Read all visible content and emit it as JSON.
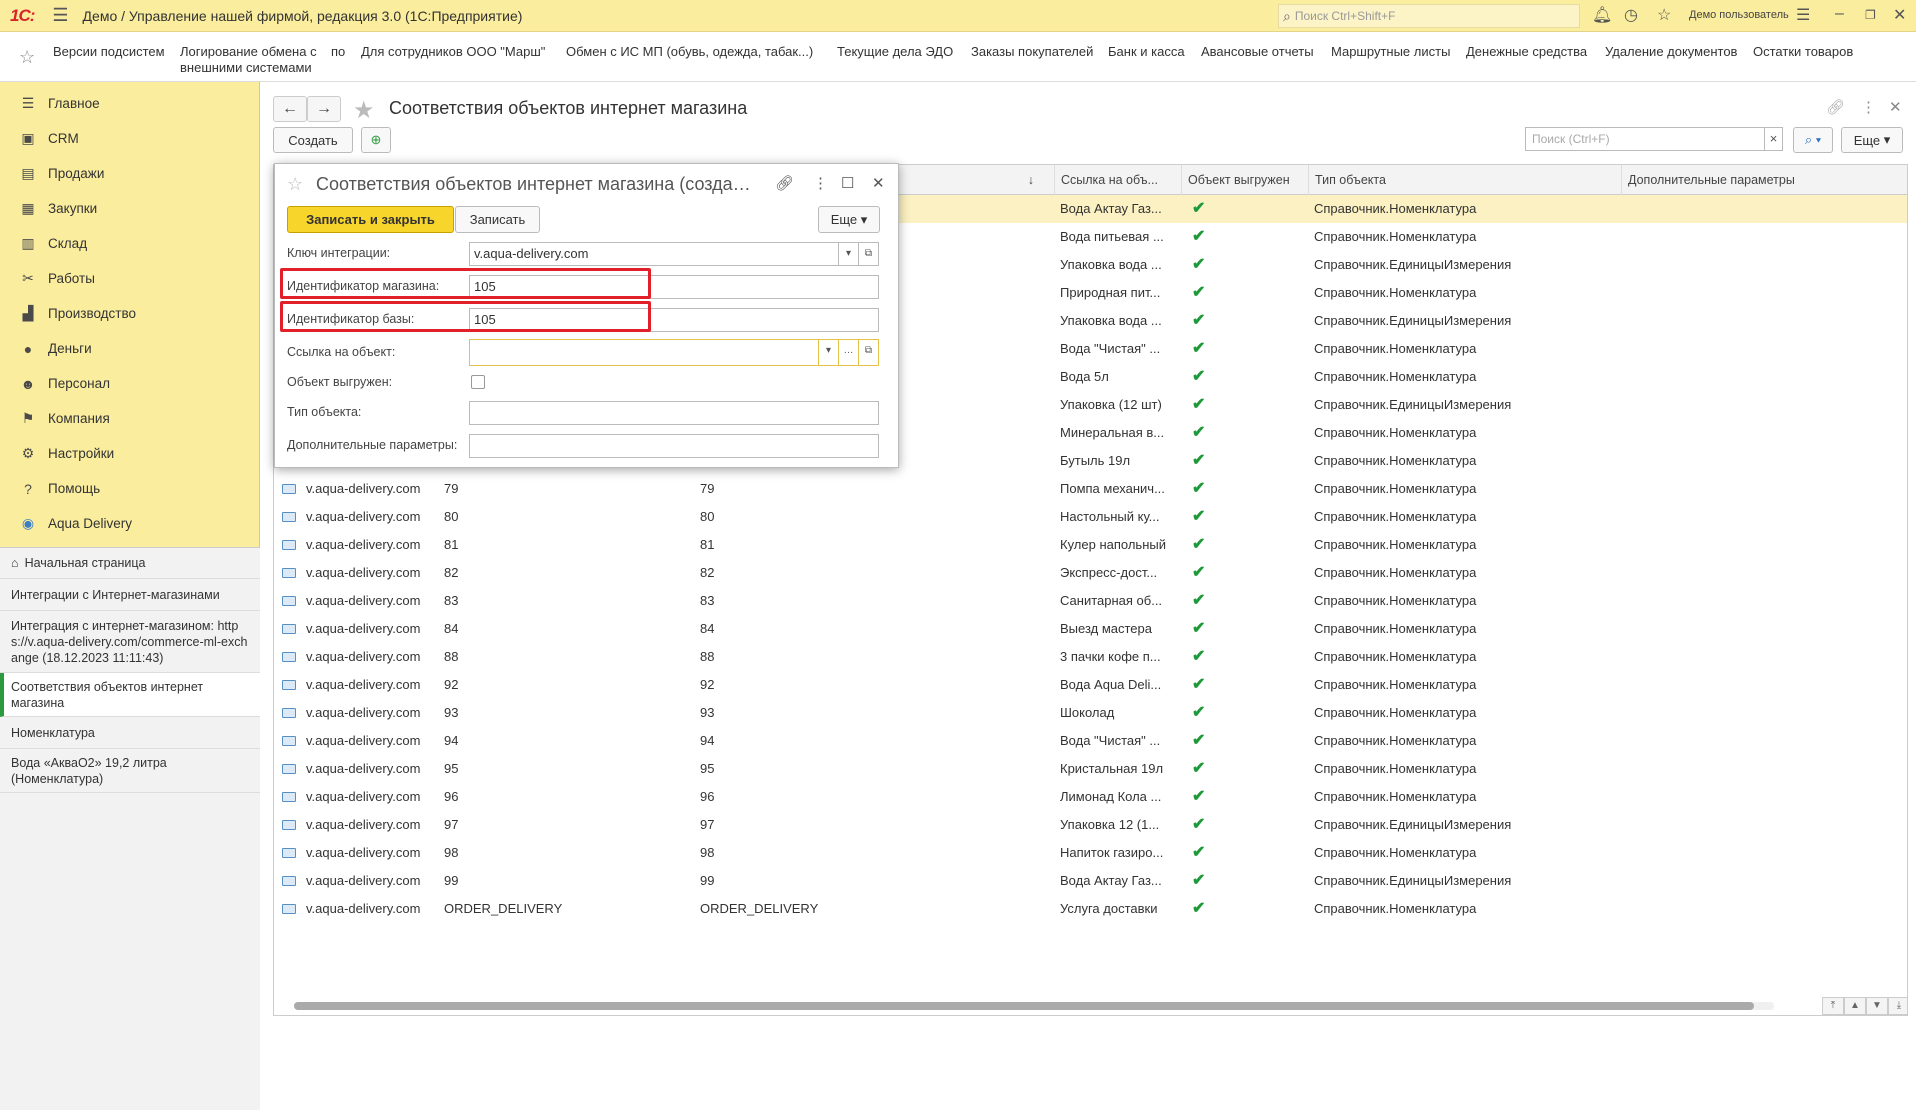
{
  "titlebar": {
    "logo": "1С:",
    "title": "Демо / Управление нашей фирмой, редакция 3.0  (1С:Предприятие)",
    "search_placeholder": "Поиск Ctrl+Shift+F",
    "user": "Демо пользователь"
  },
  "favorites": [
    "Версии подсистем",
    "Логирование обмена с",
    "внешними системами",
    "по",
    "Для сотрудников ООО \"Марш\"",
    "Обмен с ИС МП (обувь, одежда, табак...)",
    "Текущие дела ЭДО",
    "Заказы покупателей",
    "Банк и касса",
    "Авансовые отчеты",
    "Маршрутные листы",
    "Денежные средства",
    "Удаление документов",
    "Остатки товаров"
  ],
  "sidebar": {
    "items": [
      {
        "label": "Главное",
        "icon": "menu-icon"
      },
      {
        "label": "CRM",
        "icon": "crm-icon"
      },
      {
        "label": "Продажи",
        "icon": "sales-icon"
      },
      {
        "label": "Закупки",
        "icon": "purchases-icon"
      },
      {
        "label": "Склад",
        "icon": "warehouse-icon"
      },
      {
        "label": "Работы",
        "icon": "tools-icon"
      },
      {
        "label": "Производство",
        "icon": "factory-icon"
      },
      {
        "label": "Деньги",
        "icon": "money-icon"
      },
      {
        "label": "Персонал",
        "icon": "people-icon"
      },
      {
        "label": "Компания",
        "icon": "flag-icon"
      },
      {
        "label": "Настройки",
        "icon": "gear-icon"
      },
      {
        "label": "Помощь",
        "icon": "help-icon"
      },
      {
        "label": "Aqua Delivery",
        "icon": "location-icon"
      }
    ],
    "open_windows": [
      "Начальная страница",
      "Интеграции с Интернет-магазинами",
      "Интеграция с интернет-магазином: https://v.aqua-delivery.com/commerce-ml-exchange (18.12.2023 11:11:43)",
      "Соответствия объектов интернет магазина",
      "Номенклатура",
      "Вода «АкваО2» 19,2 литра (Номенклатура)"
    ]
  },
  "page": {
    "title": "Соответствия объектов интернет магазина",
    "create_label": "Создать",
    "search_placeholder": "Поиск (Ctrl+F)",
    "clear_label": "×",
    "more_label": "Еще",
    "columns": [
      "↓",
      "Ссылка на объ...",
      "Объект выгружен",
      "Тип объекта",
      "Дополнительные параметры"
    ],
    "rows": [
      {
        "key": "",
        "shop": "",
        "base": "",
        "link": "Вода Актау Газ...",
        "uploaded": "✔",
        "type": "Справочник.Номенклатура"
      },
      {
        "key": "",
        "shop": "",
        "base": "",
        "link": "Вода питьевая ...",
        "uploaded": "✔",
        "type": "Справочник.Номенклатура"
      },
      {
        "key": "",
        "shop": "",
        "base": "",
        "link": "Упаковка вода ...",
        "uploaded": "✔",
        "type": "Справочник.ЕдиницыИзмерения"
      },
      {
        "key": "",
        "shop": "",
        "base": "",
        "link": "Природная пит...",
        "uploaded": "✔",
        "type": "Справочник.Номенклатура"
      },
      {
        "key": "",
        "shop": "",
        "base": "",
        "link": "Упаковка вода ...",
        "uploaded": "✔",
        "type": "Справочник.ЕдиницыИзмерения"
      },
      {
        "key": "",
        "shop": "",
        "base": "",
        "link": "Вода \"Чистая\" ...",
        "uploaded": "✔",
        "type": "Справочник.Номенклатура"
      },
      {
        "key": "",
        "shop": "",
        "base": "",
        "link": "Вода 5л",
        "uploaded": "✔",
        "type": "Справочник.Номенклатура"
      },
      {
        "key": "",
        "shop": "",
        "base": "",
        "link": "Упаковка (12 шт)",
        "uploaded": "✔",
        "type": "Справочник.ЕдиницыИзмерения"
      },
      {
        "key": "",
        "shop": "",
        "base": "",
        "link": "Минеральная в...",
        "uploaded": "✔",
        "type": "Справочник.Номенклатура"
      },
      {
        "key": "",
        "shop": "",
        "base": "",
        "link": "Бутыль 19л",
        "uploaded": "✔",
        "type": "Справочник.Номенклатура"
      },
      {
        "key": "v.aqua-delivery.com",
        "shop": "79",
        "base": "79",
        "link": "Помпа механич...",
        "uploaded": "✔",
        "type": "Справочник.Номенклатура"
      },
      {
        "key": "v.aqua-delivery.com",
        "shop": "80",
        "base": "80",
        "link": "Настольный ку...",
        "uploaded": "✔",
        "type": "Справочник.Номенклатура"
      },
      {
        "key": "v.aqua-delivery.com",
        "shop": "81",
        "base": "81",
        "link": "Кулер напольный",
        "uploaded": "✔",
        "type": "Справочник.Номенклатура"
      },
      {
        "key": "v.aqua-delivery.com",
        "shop": "82",
        "base": "82",
        "link": "Экспресс-дост...",
        "uploaded": "✔",
        "type": "Справочник.Номенклатура"
      },
      {
        "key": "v.aqua-delivery.com",
        "shop": "83",
        "base": "83",
        "link": "Санитарная об...",
        "uploaded": "✔",
        "type": "Справочник.Номенклатура"
      },
      {
        "key": "v.aqua-delivery.com",
        "shop": "84",
        "base": "84",
        "link": "Выезд мастера",
        "uploaded": "✔",
        "type": "Справочник.Номенклатура"
      },
      {
        "key": "v.aqua-delivery.com",
        "shop": "88",
        "base": "88",
        "link": "3 пачки кофе п...",
        "uploaded": "✔",
        "type": "Справочник.Номенклатура"
      },
      {
        "key": "v.aqua-delivery.com",
        "shop": "92",
        "base": "92",
        "link": "Вода Aqua Deli...",
        "uploaded": "✔",
        "type": "Справочник.Номенклатура"
      },
      {
        "key": "v.aqua-delivery.com",
        "shop": "93",
        "base": "93",
        "link": "Шоколад",
        "uploaded": "✔",
        "type": "Справочник.Номенклатура"
      },
      {
        "key": "v.aqua-delivery.com",
        "shop": "94",
        "base": "94",
        "link": "Вода \"Чистая\" ...",
        "uploaded": "✔",
        "type": "Справочник.Номенклатура"
      },
      {
        "key": "v.aqua-delivery.com",
        "shop": "95",
        "base": "95",
        "link": "Кристальная 19л",
        "uploaded": "✔",
        "type": "Справочник.Номенклатура"
      },
      {
        "key": "v.aqua-delivery.com",
        "shop": "96",
        "base": "96",
        "link": "Лимонад Кола ...",
        "uploaded": "✔",
        "type": "Справочник.Номенклатура"
      },
      {
        "key": "v.aqua-delivery.com",
        "shop": "97",
        "base": "97",
        "link": "Упаковка 12 (1...",
        "uploaded": "✔",
        "type": "Справочник.ЕдиницыИзмерения"
      },
      {
        "key": "v.aqua-delivery.com",
        "shop": "98",
        "base": "98",
        "link": "Напиток газиро...",
        "uploaded": "✔",
        "type": "Справочник.Номенклатура"
      },
      {
        "key": "v.aqua-delivery.com",
        "shop": "99",
        "base": "99",
        "link": "Вода Актау Газ...",
        "uploaded": "✔",
        "type": "Справочник.ЕдиницыИзмерения"
      },
      {
        "key": "v.aqua-delivery.com",
        "shop": "ORDER_DELIVERY",
        "base": "ORDER_DELIVERY",
        "link": "Услуга доставки",
        "uploaded": "✔",
        "type": "Справочник.Номенклатура"
      }
    ]
  },
  "dialog": {
    "title": "Соответствия объектов интернет магазина (создание)",
    "save_close_label": "Записать и закрыть",
    "save_label": "Записать",
    "more_label": "Еще",
    "fields": {
      "key_label": "Ключ интеграции:",
      "key_value": "v.aqua-delivery.com",
      "shop_id_label": "Идентификатор магазина:",
      "shop_id_value": "105",
      "base_id_label": "Идентификатор базы:",
      "base_id_value": "105",
      "link_label": "Ссылка на объект:",
      "link_value": "",
      "uploaded_label": "Объект выгружен:",
      "type_label": "Тип объекта:",
      "type_value": "",
      "params_label": "Дополнительные параметры:",
      "params_value": ""
    }
  },
  "colors": {
    "accent_yellow": "#fbed9e",
    "primary_button": "#f7d52a",
    "highlight_red": "#e2202a",
    "check_green": "#1e9a3a"
  }
}
